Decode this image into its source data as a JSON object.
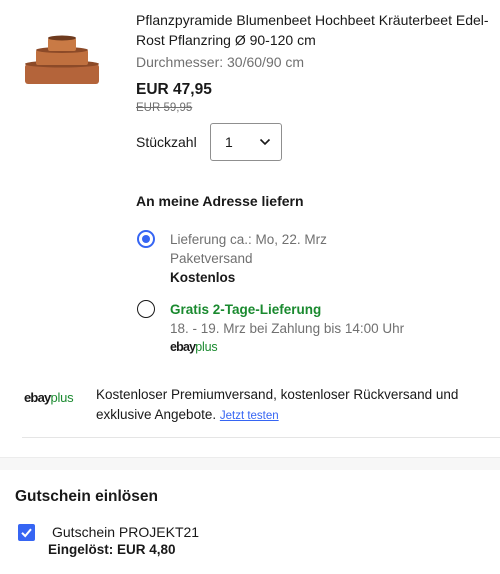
{
  "product": {
    "title": "Pflanzpyramide Blumenbeet Hochbeet Kräuterbeet Edel-Rost Pflanzring Ø 90-120 cm",
    "variant": "Durchmesser: 30/60/90 cm",
    "price": "EUR 47,95",
    "original_price": "EUR 59,95",
    "image_icon": "rust-planter-pyramid-image"
  },
  "quantity": {
    "label": "Stückzahl",
    "value": "1"
  },
  "delivery": {
    "title": "An meine Adresse liefern",
    "options": [
      {
        "selected": true,
        "line1": "Lieferung ca.: Mo, 22. Mrz",
        "line2": "Paketversand",
        "line3": "Kostenlos"
      },
      {
        "selected": false,
        "line1": "Gratis 2-Tage-Lieferung",
        "line2": "18. - 19. Mrz bei Zahlung bis 14:00 Uhr",
        "badge_ebay": "ebay",
        "badge_plus": "plus"
      }
    ]
  },
  "promo": {
    "logo_ebay": "ebay",
    "logo_plus": "plus",
    "text": "Kostenloser Premiumversand, kostenloser Rückversand und exklusive Angebote.",
    "link": "Jetzt testen"
  },
  "coupon": {
    "title": "Gutschein einlösen",
    "checked": true,
    "name": "Gutschein PROJEKT21",
    "applied": "Eingelöst: EUR 4,80"
  },
  "colors": {
    "accent_blue": "#3665f3",
    "plus_green": "#1a8a2f",
    "rust": "#b4643a"
  }
}
